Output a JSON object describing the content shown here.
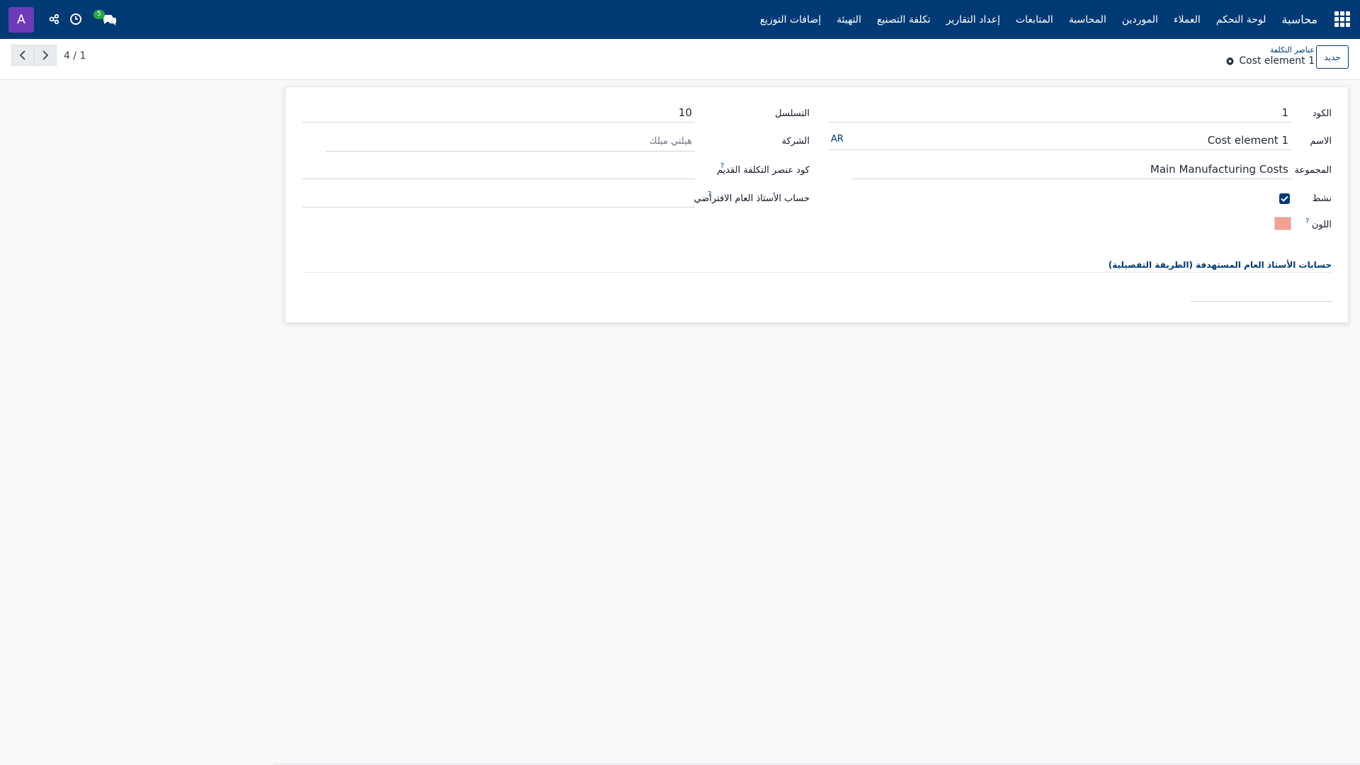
{
  "user": {
    "avatar_letter": "A"
  },
  "navbar": {
    "message_count": "5",
    "menu": [
      "محاسبة",
      "لوحة التحكم",
      "العملاء",
      "الموردين",
      "المحاسبة",
      "المتابعات",
      "إعداد التقارير",
      "تكلفة التصنيع",
      "التهيئة",
      "إضافات التوزيع"
    ]
  },
  "control_panel": {
    "pager": "4 / 1",
    "new_label": "جديد",
    "breadcrumb_parent": "عناصر التكلفة",
    "breadcrumb_current": "Cost element 1"
  },
  "form": {
    "code_label": "الكود",
    "code_value": "1",
    "name_label": "الاسم",
    "name_value": "Cost element 1",
    "name_lang": "AR",
    "group_label": "المجموعة",
    "group_value": "Main Manufacturing Costs",
    "active_label": "نشط",
    "active_checked": true,
    "color_label": "اللون",
    "color_value": "#f4a090",
    "sequence_label": "التسلسل",
    "sequence_value": "10",
    "company_label": "الشركة",
    "company_value": "هيلتي ميلك",
    "old_code_label": "كود عنصر التكلفة القديم",
    "old_code_value": "",
    "default_account_label": "حساب الأستاذ العام الافتراضي",
    "default_account_value": "",
    "help_mark": "?",
    "target_accounts_title": "حسابات الأستاذ العام المستهدفة (الطريقة التفصيلية)"
  },
  "colors": {
    "navbar": "#013a75",
    "avatar": "#6d3bb8",
    "badge": "#28a745"
  }
}
